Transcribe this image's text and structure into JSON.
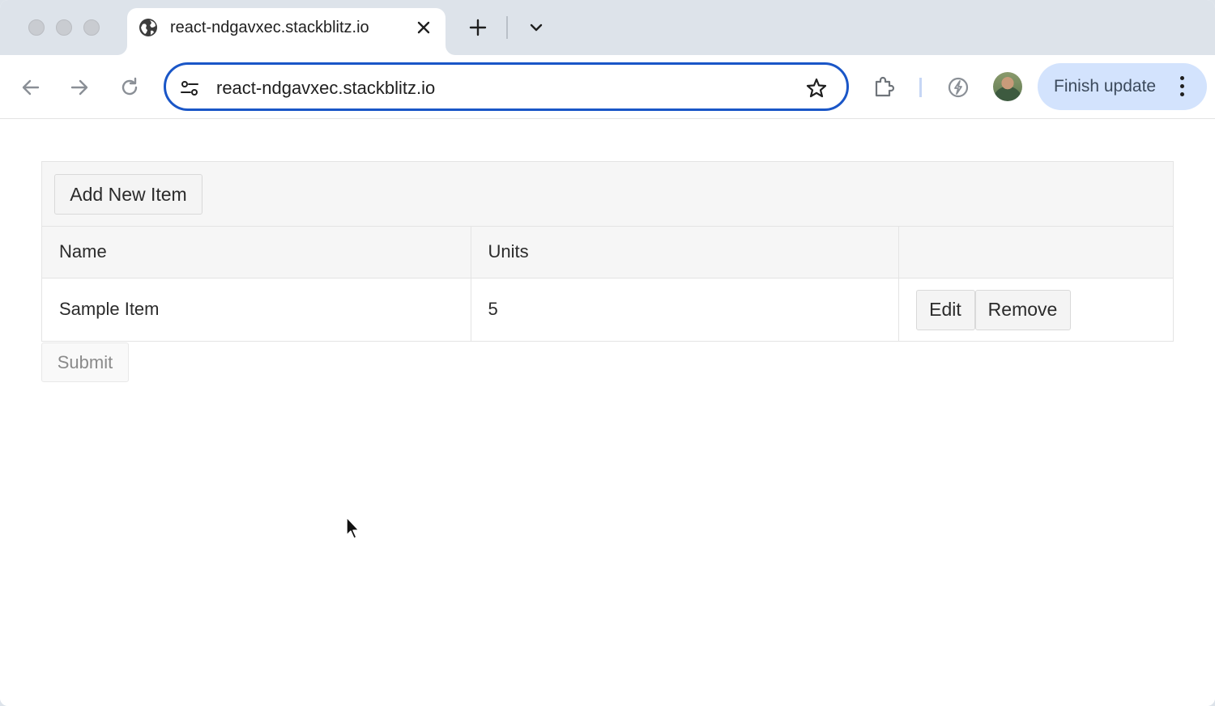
{
  "browser": {
    "tab": {
      "title": "react-ndgavxec.stackblitz.io"
    },
    "address_bar": {
      "url": "react-ndgavxec.stackblitz.io"
    },
    "update_button": {
      "label": "Finish update"
    },
    "colors": {
      "accent": "#1a56c7",
      "update_bg": "#d3e3fd",
      "frame": "#dde3ea"
    },
    "icons": [
      "globe-icon",
      "close-icon",
      "plus-icon",
      "chevron-down-icon",
      "back-arrow-icon",
      "forward-arrow-icon",
      "reload-icon",
      "site-info-icon",
      "star-icon",
      "extensions-icon",
      "bolt-icon",
      "kebab-menu-icon"
    ]
  },
  "page": {
    "toolbar": {
      "add_label": "Add New Item"
    },
    "columns": [
      {
        "title": "Name"
      },
      {
        "title": "Units"
      },
      {
        "title": ""
      }
    ],
    "rows": [
      {
        "name": "Sample Item",
        "units": "5",
        "edit_label": "Edit",
        "remove_label": "Remove"
      }
    ],
    "submit_label": "Submit"
  }
}
